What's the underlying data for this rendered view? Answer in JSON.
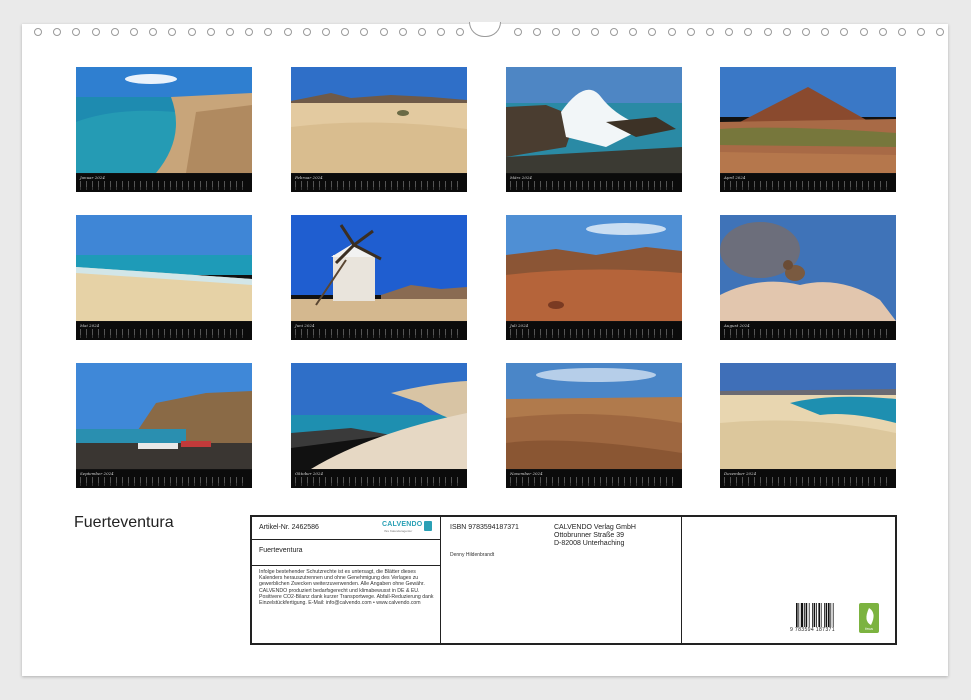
{
  "calendar": {
    "title": "Fuerteventura",
    "months": [
      {
        "label": "Januar 2024"
      },
      {
        "label": "Februar 2024"
      },
      {
        "label": "März 2024"
      },
      {
        "label": "April 2024"
      },
      {
        "label": "Mai 2024"
      },
      {
        "label": "Juni 2024"
      },
      {
        "label": "Juli 2024"
      },
      {
        "label": "August 2024"
      },
      {
        "label": "September 2024"
      },
      {
        "label": "Oktober 2024"
      },
      {
        "label": "November 2024"
      },
      {
        "label": "Dezember 2024"
      }
    ]
  },
  "info": {
    "article": "Artikel-Nr. 2462586",
    "brand": "CALVENDO",
    "brand_sub": "Ihre Kalenderagentur",
    "product_name": "Fuerteventura",
    "legal": "Infolge bestehender Schutzrechte ist es untersagt, die Blätter dieses Kalenders herauszutrennen und ohne Genehmigung des Verlages zu gewerblichen Zwecken weiterzuverwenden. Alle Angaben ohne Gewähr. CALVENDO produziert bedarfsgerecht und klimabewusst in DE & EU. Positivere CO2-Bilanz dank kurzer Transportwege. Abfall-Reduzierung dank Einzelstückfertigung. E-Mail: info@calvendo.com • www.calvendo.com",
    "isbn": "ISBN 9783594187371",
    "publisher_line1": "CALVENDO Verlag GmbH",
    "publisher_line2": "Ottobrunner Straße 39",
    "publisher_line3": "D-82008 Unterhaching",
    "author": "Denny Hildenbrandt",
    "barcode_number": "9 783594 187371",
    "eco_label": "feca"
  }
}
